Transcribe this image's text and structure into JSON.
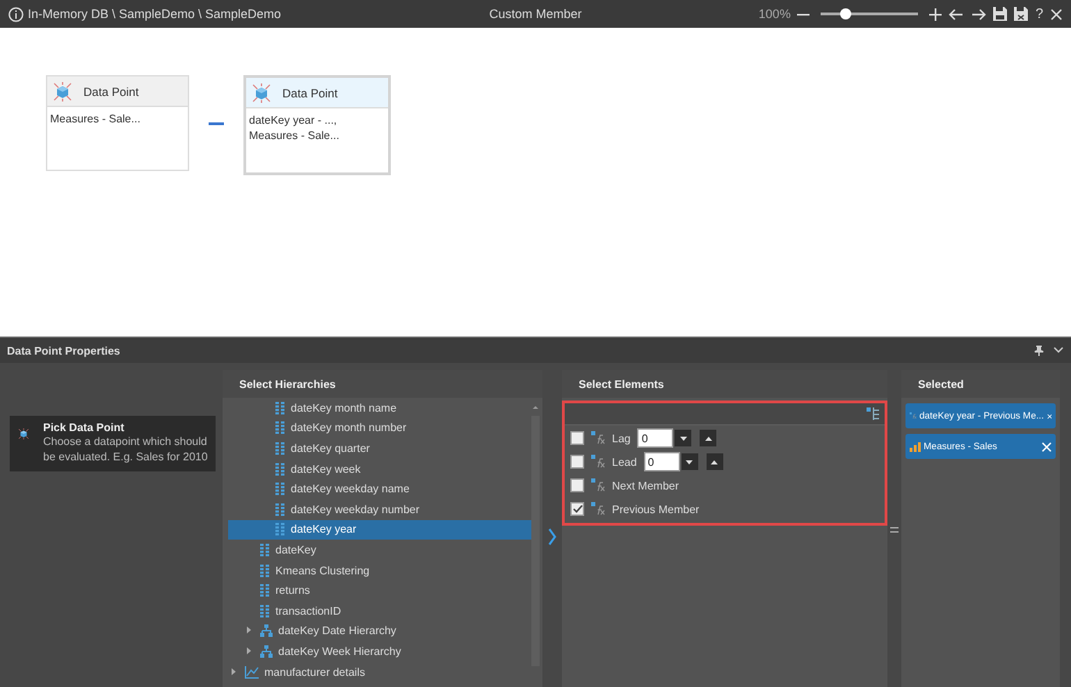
{
  "window": {
    "breadcrumb": "In-Memory DB \\ SampleDemo \\ SampleDemo",
    "title": "Custom Member",
    "zoom": {
      "reading": "100%",
      "level": 0.25
    },
    "help": "?"
  },
  "canvas": {
    "cards": [
      {
        "title": "Data Point",
        "body": "Measures - Sale...",
        "selected": false
      },
      {
        "title": "Data Point",
        "body": "dateKey year - ..., Measures - Sale...",
        "selected": true
      }
    ]
  },
  "properties": {
    "title": "Data Point Properties",
    "steps": [
      {
        "title": "Pick Data Point",
        "description": "Choose a datapoint which should be evaluated. E.g. Sales for 2010",
        "selected": true
      }
    ],
    "hierarchies": {
      "title": "Select Hierarchies",
      "items": [
        {
          "children": [
            {
              "children": [
                {
                  "kind": "attribute",
                  "label": "dateKey month name",
                  "selected": false
                },
                {
                  "kind": "attribute",
                  "label": "dateKey month number",
                  "selected": false
                },
                {
                  "kind": "attribute",
                  "label": "dateKey quarter",
                  "selected": false
                },
                {
                  "kind": "attribute",
                  "label": "dateKey week",
                  "selected": false
                },
                {
                  "kind": "attribute",
                  "label": "dateKey weekday name",
                  "selected": false
                },
                {
                  "kind": "attribute",
                  "label": "dateKey weekday number",
                  "selected": false
                },
                {
                  "kind": "attribute",
                  "label": "dateKey year",
                  "selected": true
                }
              ]
            },
            {
              "kind": "attribute",
              "label": "dateKey",
              "selected": false
            },
            {
              "kind": "attribute",
              "label": "Kmeans Clustering",
              "selected": false
            },
            {
              "kind": "attribute",
              "label": "returns",
              "selected": false
            },
            {
              "kind": "attribute",
              "label": "transactionID",
              "selected": false
            },
            {
              "kind": "hierarchy",
              "label": "dateKey Date Hierarchy",
              "selected": false,
              "expanded": false
            },
            {
              "kind": "hierarchy",
              "label": "dateKey Week Hierarchy",
              "selected": false,
              "expanded": false
            }
          ]
        },
        {
          "kind": "folder",
          "label": "manufacturer details",
          "selected": false,
          "expanded": false
        }
      ]
    },
    "elements": {
      "title": "Select Elements",
      "items": [
        {
          "kind": "offset",
          "label": "Lag",
          "value": "0",
          "checked": false
        },
        {
          "kind": "offset",
          "label": "Lead",
          "value": "0",
          "checked": false
        },
        {
          "kind": "plain",
          "label": "Next Member",
          "checked": false
        },
        {
          "kind": "plain",
          "label": "Previous Member",
          "checked": true
        }
      ]
    },
    "selected": {
      "title": "Selected",
      "items": [
        {
          "kind": "calculated",
          "label": "dateKey year - Previous Me..."
        },
        {
          "kind": "measure",
          "label": "Measures - Sales"
        }
      ]
    }
  }
}
